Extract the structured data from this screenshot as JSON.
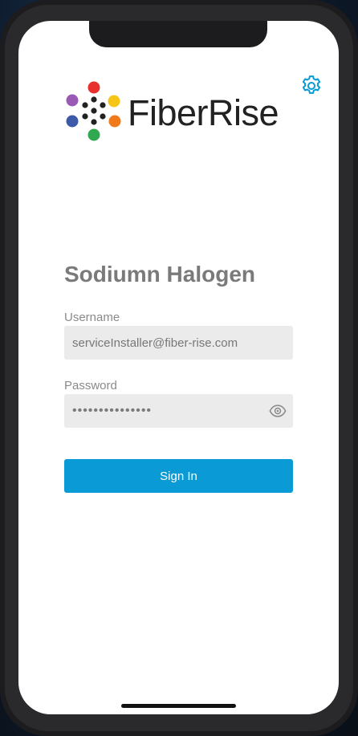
{
  "app": {
    "logo_text": "FiberRise"
  },
  "login": {
    "title": "Sodiumn Halogen",
    "username_label": "Username",
    "username_value": "serviceInstaller@fiber-rise.com",
    "password_label": "Password",
    "password_value": "•••••••••••••••",
    "sign_in_label": "Sign In"
  },
  "icons": {
    "settings": "gear-icon",
    "password_visibility": "eye-icon"
  },
  "colors": {
    "accent": "#0a9bd6",
    "title_text": "#7a7a7a",
    "field_background": "#ebebeb",
    "logo_dots": [
      "#e8312f",
      "#f5c518",
      "#f07a1a",
      "#2fa84f",
      "#3d5aa8",
      "#9b59b6",
      "#222222"
    ]
  }
}
